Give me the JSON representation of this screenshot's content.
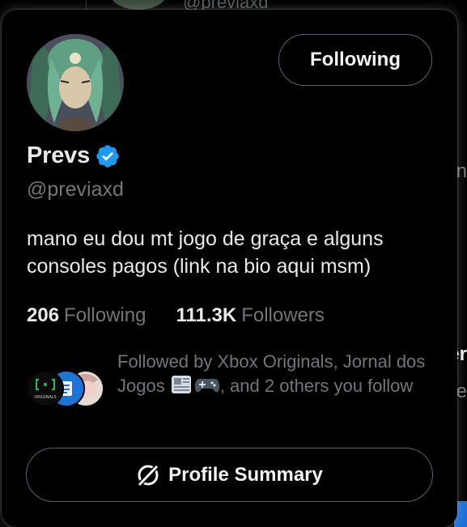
{
  "background": {
    "top_handle": "@previaxd",
    "right_fragments": [
      "n",
      "er",
      "e"
    ]
  },
  "profile": {
    "name": "Prevs",
    "verified_icon": "verified-badge-icon",
    "handle": "@previaxd",
    "bio": "mano eu dou mt jogo de graça e alguns consoles pagos (link na bio aqui msm)"
  },
  "follow_button": {
    "label": "Following"
  },
  "stats": {
    "following_count": "206",
    "following_label": "Following",
    "followers_count": "111.3K",
    "followers_label": "Followers"
  },
  "followed_by": {
    "text_part1": "Followed by Xbox Originals, Jornal dos Jogos ",
    "text_part2": ", and 2 others you follow",
    "emojis": [
      "newspaper-icon",
      "game-controller-icon"
    ],
    "badge_text": "ORIGINALS"
  },
  "summary_button": {
    "label": "Profile Summary",
    "icon": "grok-icon"
  },
  "colors": {
    "background": "#000000",
    "text_primary": "#e7e9ea",
    "text_secondary": "#71767b",
    "border": "#536471",
    "verified_blue": "#1d9bf0"
  }
}
